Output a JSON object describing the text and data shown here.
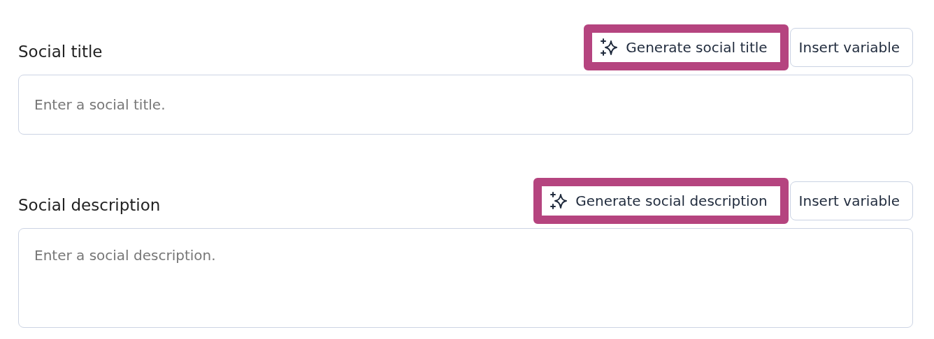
{
  "fields": [
    {
      "label": "Social title",
      "kind": "single",
      "placeholder": "Enter a social title.",
      "buttons": [
        {
          "label": "Generate social title",
          "kind": "generate",
          "highlighted": true
        },
        {
          "label": "Insert variable",
          "kind": "plain",
          "highlighted": false
        }
      ]
    },
    {
      "label": "Social description",
      "kind": "multi",
      "placeholder": "Enter a social description.",
      "buttons": [
        {
          "label": "Generate social description",
          "kind": "generate",
          "highlighted": true
        },
        {
          "label": "Insert variable",
          "kind": "plain",
          "highlighted": false
        }
      ]
    }
  ]
}
